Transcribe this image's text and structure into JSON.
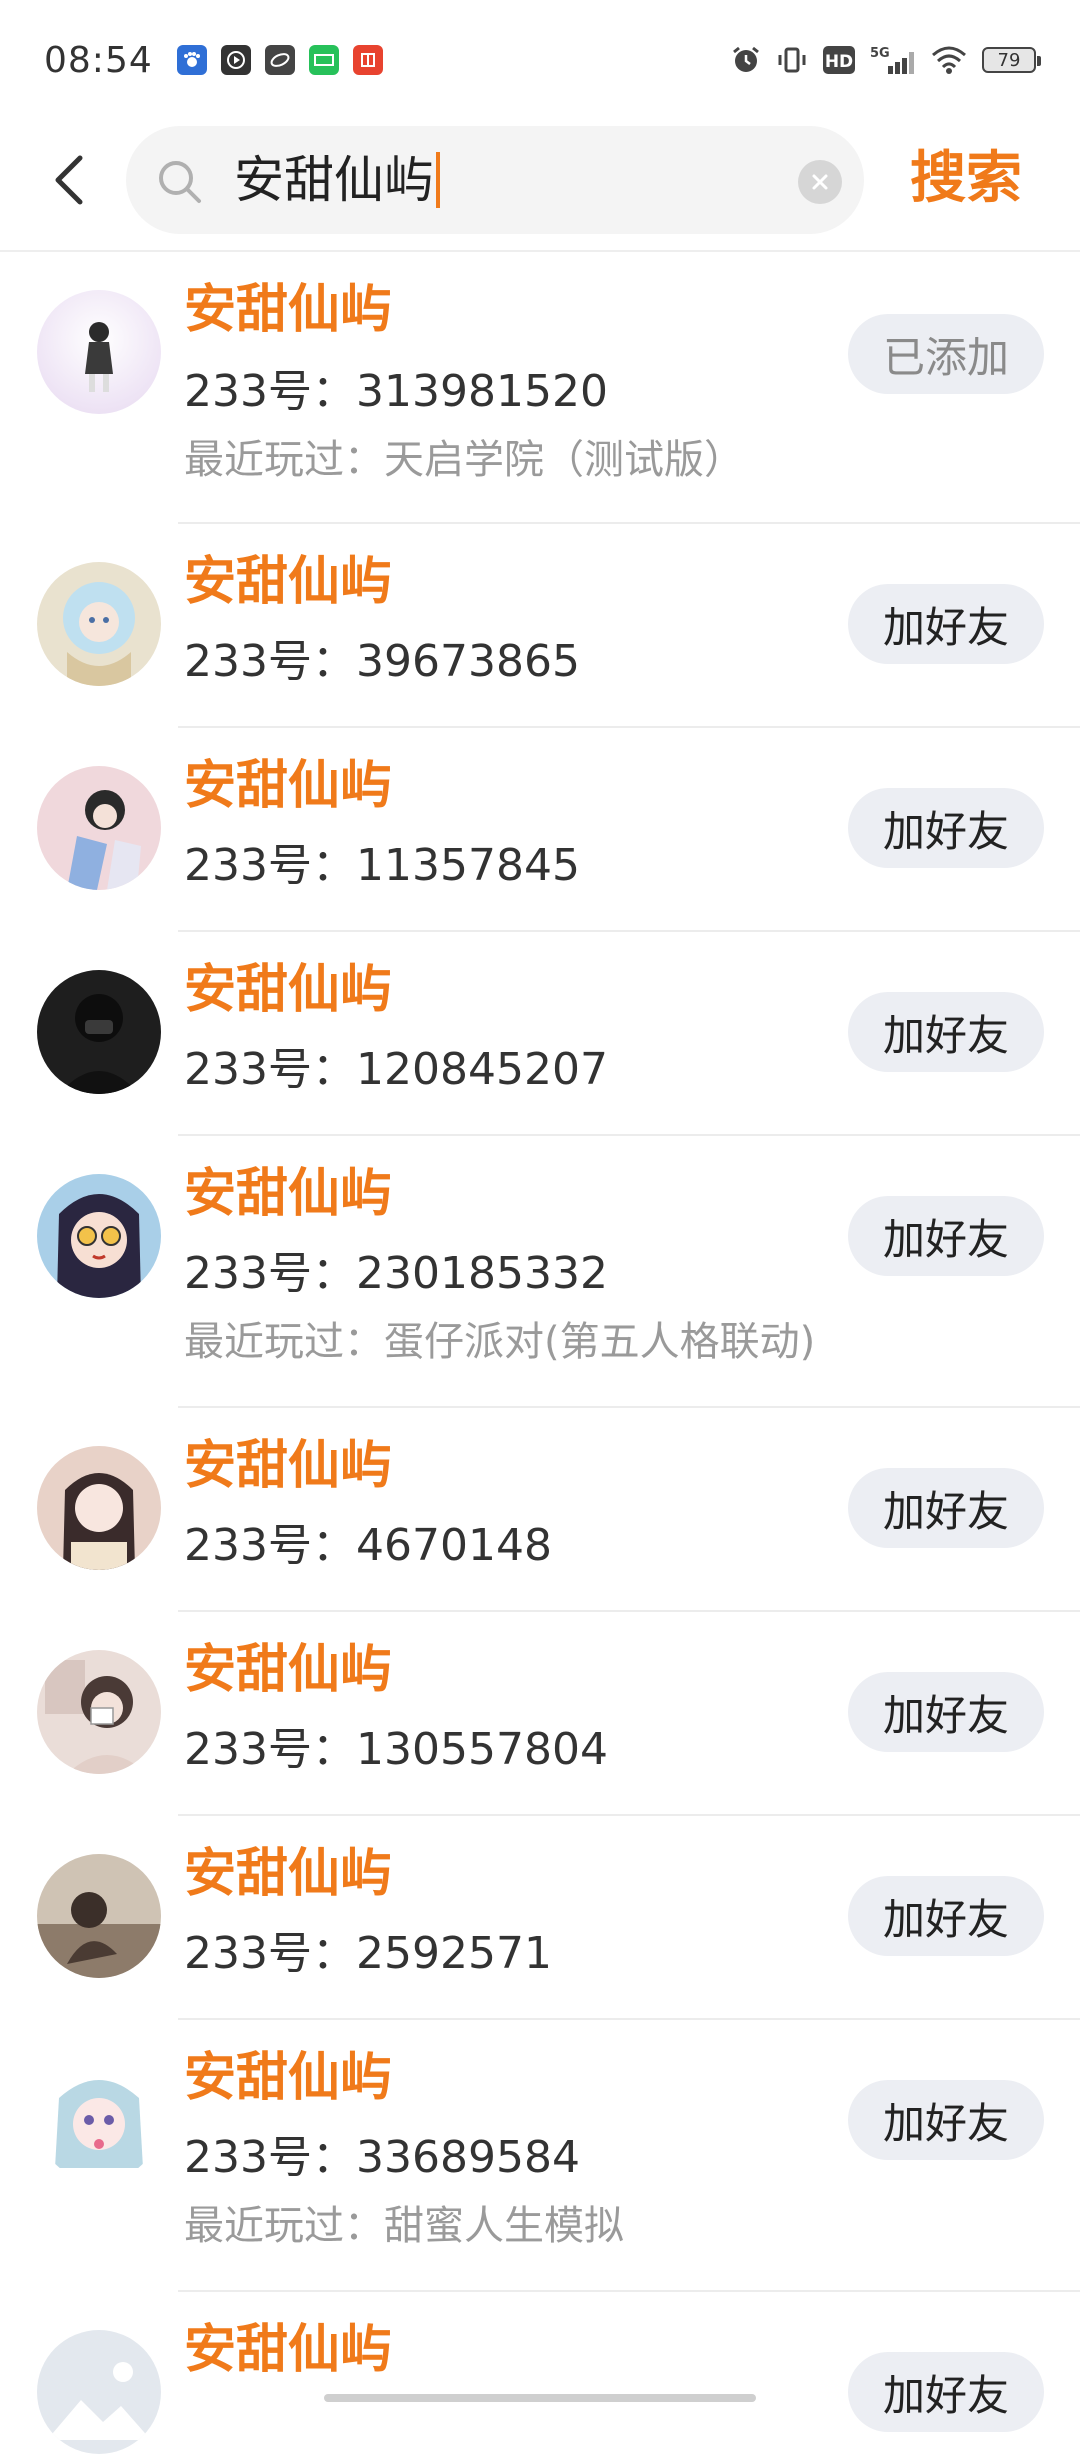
{
  "status_bar": {
    "time": "08:54",
    "battery": "79",
    "network": "5G",
    "hd": "HD"
  },
  "search": {
    "query": "安甜仙屿",
    "submit_label": "搜索"
  },
  "results": [
    {
      "name": "安甜仙屿",
      "id_label": "233号：",
      "id": "313981520",
      "recent_label": "最近玩过：",
      "recent": "天启学院（测试版）",
      "action": "已添加"
    },
    {
      "name": "安甜仙屿",
      "id_label": "233号：",
      "id": "39673865",
      "recent_label": "",
      "recent": "",
      "action": "加好友"
    },
    {
      "name": "安甜仙屿",
      "id_label": "233号：",
      "id": "11357845",
      "recent_label": "",
      "recent": "",
      "action": "加好友"
    },
    {
      "name": "安甜仙屿",
      "id_label": "233号：",
      "id": "120845207",
      "recent_label": "",
      "recent": "",
      "action": "加好友"
    },
    {
      "name": "安甜仙屿",
      "id_label": "233号：",
      "id": "230185332",
      "recent_label": "最近玩过：",
      "recent": "蛋仔派对(第五人格联动)",
      "action": "加好友"
    },
    {
      "name": "安甜仙屿",
      "id_label": "233号：",
      "id": "4670148",
      "recent_label": "",
      "recent": "",
      "action": "加好友"
    },
    {
      "name": "安甜仙屿",
      "id_label": "233号：",
      "id": "130557804",
      "recent_label": "",
      "recent": "",
      "action": "加好友"
    },
    {
      "name": "安甜仙屿",
      "id_label": "233号：",
      "id": "2592571",
      "recent_label": "",
      "recent": "",
      "action": "加好友"
    },
    {
      "name": "安甜仙屿",
      "id_label": "233号：",
      "id": "33689584",
      "recent_label": "最近玩过：",
      "recent": "甜蜜人生模拟",
      "action": "加好友"
    },
    {
      "name": "安甜仙屿",
      "id_label": "",
      "id": "",
      "recent_label": "",
      "recent": "",
      "action": "加好友"
    }
  ],
  "colors": {
    "accent": "#f07a1a",
    "button_bg": "#eceef3",
    "muted_text": "#9a9a9a"
  }
}
